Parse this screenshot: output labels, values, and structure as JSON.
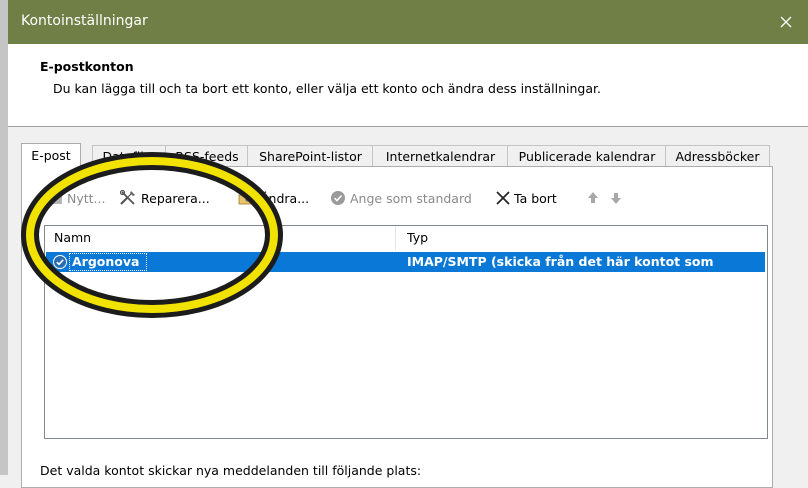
{
  "window": {
    "title": "Kontoinställningar"
  },
  "header": {
    "title": "E-postkonton",
    "description": "Du kan lägga till och ta bort ett konto, eller välja ett konto och ändra dess inställningar."
  },
  "tabs": [
    {
      "label": "E-post",
      "active": true
    },
    {
      "label": "Datafiler"
    },
    {
      "label": "RSS-feeds"
    },
    {
      "label": "SharePoint-listor"
    },
    {
      "label": "Internetkalendrar"
    },
    {
      "label": "Publicerade kalendrar"
    },
    {
      "label": "Adressböcker"
    }
  ],
  "toolbar": {
    "new_label": "Nytt...",
    "repair_label": "Reparera...",
    "change_label": "Ändra...",
    "set_default_label": "Ange som standard",
    "remove_label": "Ta bort"
  },
  "list": {
    "columns": [
      "Namn",
      "Typ"
    ],
    "rows": [
      {
        "name": "Argonova",
        "type": "IMAP/SMTP (skicka från det här kontot som standa..."
      }
    ]
  },
  "footer": {
    "text": "Det valda kontot skickar nya meddelanden till följande plats:"
  },
  "colors": {
    "titlebar": "#6f7f45",
    "selection": "#0a78d7",
    "highlight_ring": "#f2e200"
  },
  "icons": [
    "close-icon",
    "new-account-icon",
    "repair-icon",
    "change-icon",
    "check-circle-icon",
    "remove-x-icon",
    "move-up-icon",
    "move-down-icon",
    "default-account-check-icon"
  ]
}
